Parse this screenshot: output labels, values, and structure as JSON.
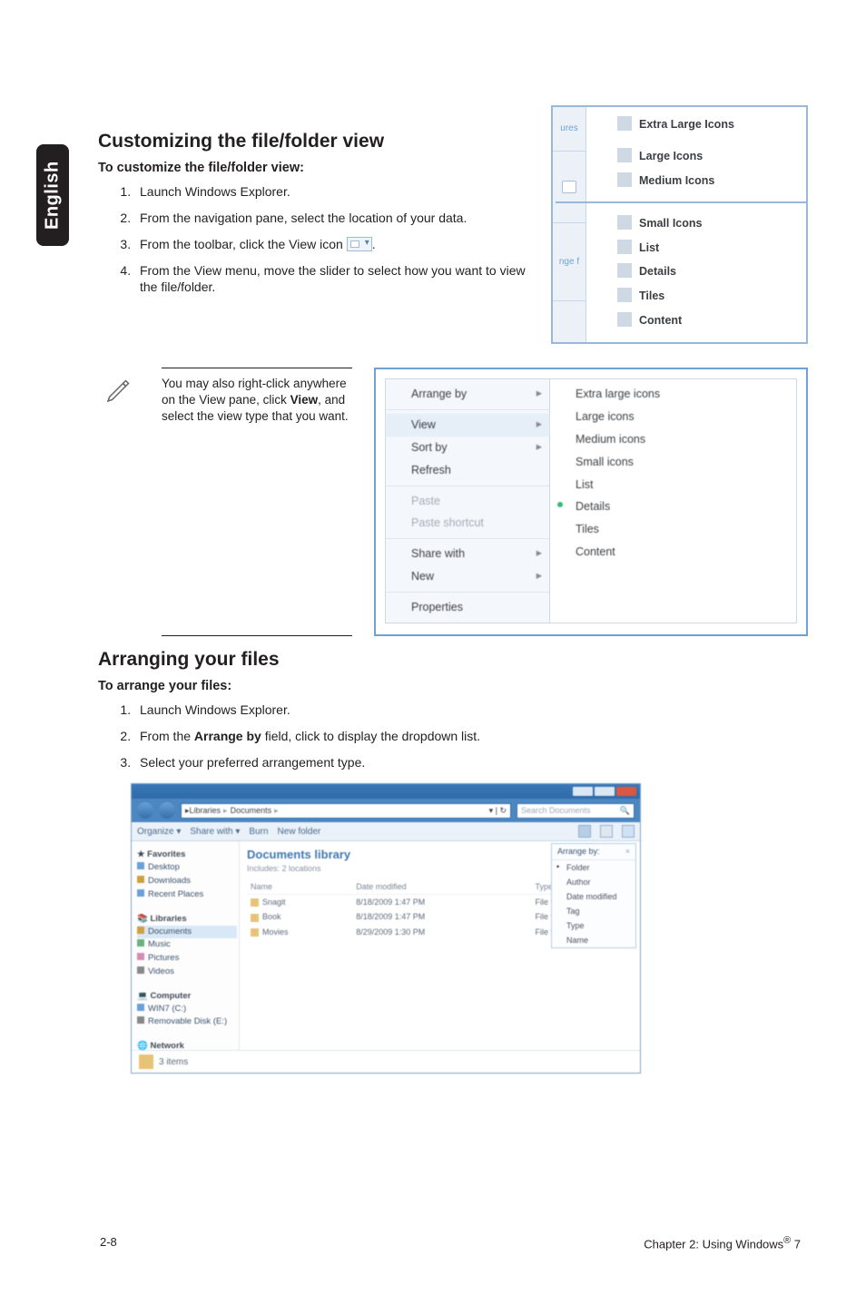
{
  "sidebar": {
    "language": "English"
  },
  "section1": {
    "heading": "Customizing the file/folder view",
    "sub": "To customize the file/folder view:",
    "steps": [
      "Launch Windows Explorer.",
      "From the navigation pane, select the location of your data.",
      "From the toolbar, click the View icon",
      "From the View menu, move the slider to select how you want to view the file/folder."
    ],
    "step3_suffix": "."
  },
  "view_popover": {
    "left_cells": [
      "ures",
      " ",
      "nge f"
    ],
    "items": [
      "Extra Large Icons",
      "Large Icons",
      "Medium Icons",
      "Small Icons",
      "List",
      "Details",
      "Tiles",
      "Content"
    ]
  },
  "note": {
    "text_pre": "You may also right-click anywhere on the View pane, click ",
    "bold": "View",
    "text_post": ", and select the view type that you want."
  },
  "context_menu": {
    "left": [
      {
        "label": "Arrange by",
        "arrow": true
      },
      {
        "label": "View",
        "arrow": true,
        "hl": true
      },
      {
        "label": "Sort by",
        "arrow": true
      },
      {
        "label": "Refresh"
      },
      {
        "sep": true
      },
      {
        "label": "Paste",
        "disabled": true
      },
      {
        "label": "Paste shortcut",
        "disabled": true
      },
      {
        "sep": true
      },
      {
        "label": "Share with",
        "arrow": true
      },
      {
        "label": "New",
        "arrow": true
      },
      {
        "sep": true
      },
      {
        "label": "Properties"
      }
    ],
    "right": [
      {
        "label": "Extra large icons"
      },
      {
        "label": "Large icons"
      },
      {
        "label": "Medium icons"
      },
      {
        "label": "Small icons"
      },
      {
        "label": "List"
      },
      {
        "label": "Details",
        "dot": true
      },
      {
        "label": "Tiles"
      },
      {
        "label": "Content"
      }
    ]
  },
  "section2": {
    "heading": "Arranging your files",
    "sub": "To arrange your files:",
    "steps_pre": [
      "Launch Windows Explorer.",
      "From the "
    ],
    "step2_bold": "Arrange by",
    "step2_post": " field, click to display the dropdown list.",
    "step3": "Select your preferred arrangement type."
  },
  "explorer": {
    "breadcrumb": [
      "Libraries",
      "Documents"
    ],
    "search_placeholder": "Search Documents",
    "toolbar": {
      "organize": "Organize ▾",
      "share": "Share with ▾",
      "burn": "Burn",
      "newfolder": "New folder"
    },
    "side": {
      "favorites": "Favorites",
      "fav_items": [
        "Desktop",
        "Downloads",
        "Recent Places"
      ],
      "libraries": "Libraries",
      "lib_items": [
        "Documents",
        "Music",
        "Pictures",
        "Videos"
      ],
      "computer": "Computer",
      "comp_items": [
        "WIN7 (C:)",
        "Removable Disk (E:)"
      ],
      "network": "Network"
    },
    "main": {
      "title": "Documents library",
      "sub": "Includes: 2 locations",
      "cols": [
        "Name",
        "Date modified",
        "Type"
      ],
      "rows": [
        [
          "Snagit",
          "8/18/2009 1:47 PM",
          "File folder"
        ],
        [
          "Book",
          "8/18/2009 1:47 PM",
          "File folder"
        ],
        [
          "Movies",
          "8/29/2009 1:30 PM",
          "File folder"
        ]
      ],
      "arrange_label": "Arrange by:",
      "arrange_value": "Folder",
      "dropdown": [
        "Folder",
        "Author",
        "Date modified",
        "Tag",
        "Type",
        "Name"
      ]
    },
    "status": {
      "count": "3 items"
    }
  },
  "footer": {
    "left": "2-8",
    "right_pre": "Chapter 2: Using Windows",
    "right_post": " 7"
  }
}
